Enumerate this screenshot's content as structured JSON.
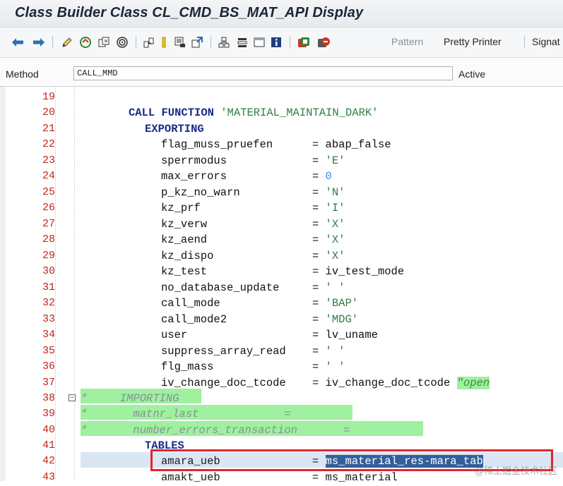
{
  "window": {
    "title": "Class Builder Class CL_CMD_BS_MAT_API Display"
  },
  "toolbar": {
    "icons": [
      "back-arrow-icon",
      "forward-arrow-icon",
      "edit-pencil-icon",
      "toggle-display-change-icon",
      "other-object-icon",
      "activate-icon",
      "where-used-icon",
      "object-list-icon",
      "navigate-icon",
      "display-object-list-icon",
      "window-icon",
      "info-icon",
      "enhance-icon",
      "help-icon"
    ],
    "pattern_label": "Pattern",
    "pretty_printer_label": "Pretty Printer",
    "signature_label": "Signat"
  },
  "method": {
    "label": "Method",
    "value": "CALL_MMD",
    "status": "Active"
  },
  "code_lines": [
    {
      "n": "19",
      "text": ""
    },
    {
      "n": "20",
      "text": "CALL FUNCTION 'MATERIAL_MAINTAIN_DARK'"
    },
    {
      "n": "21",
      "text": "EXPORTING"
    },
    {
      "n": "22",
      "text": "flag_muss_pruefen      = abap_false"
    },
    {
      "n": "23",
      "text": "sperrmodus             = 'E'"
    },
    {
      "n": "24",
      "text": "max_errors             = 0"
    },
    {
      "n": "25",
      "text": "p_kz_no_warn           = 'N'"
    },
    {
      "n": "26",
      "text": "kz_prf                 = 'I'"
    },
    {
      "n": "27",
      "text": "kz_verw                = 'X'"
    },
    {
      "n": "28",
      "text": "kz_aend                = 'X'"
    },
    {
      "n": "29",
      "text": "kz_dispo               = 'X'"
    },
    {
      "n": "30",
      "text": "kz_test                = iv_test_mode"
    },
    {
      "n": "31",
      "text": "no_database_update     = ' '"
    },
    {
      "n": "32",
      "text": "call_mode              = 'BAP'"
    },
    {
      "n": "33",
      "text": "call_mode2             = 'MDG'"
    },
    {
      "n": "34",
      "text": "user                   = lv_uname"
    },
    {
      "n": "35",
      "text": "suppress_array_read    = ' '"
    },
    {
      "n": "36",
      "text": "flg_mass               = ' '"
    },
    {
      "n": "37",
      "text": "iv_change_doc_tcode    = iv_change_doc_tcode \"open"
    },
    {
      "n": "38",
      "text": "*     IMPORTING"
    },
    {
      "n": "39",
      "text": "*       matnr_last             ="
    },
    {
      "n": "40",
      "text": "*       number_errors_transaction       ="
    },
    {
      "n": "41",
      "text": "TABLES"
    },
    {
      "n": "42",
      "text": "amara_ueb              = ms_material_res-mara_tab"
    },
    {
      "n": "43",
      "text": "amakt_ueb              = ms_material"
    }
  ],
  "watermark": "@稀土掘金技术社区",
  "colors": {
    "line_number": "#c2221c",
    "keyword": "#1a2a8a",
    "string": "#2f7d46",
    "number": "#3a8fd8",
    "comment_bg": "#9ff09f",
    "selection": "#335f99",
    "highlight_box": "#e0262b"
  }
}
